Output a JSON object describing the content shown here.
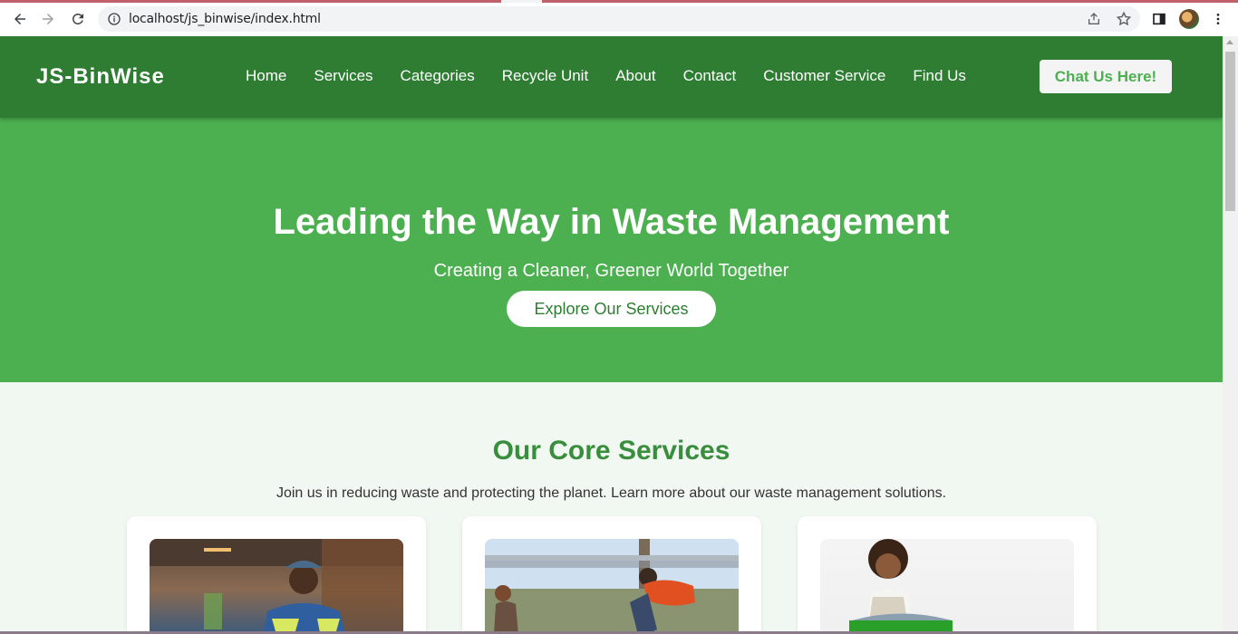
{
  "browser": {
    "url": "localhost/js_binwise/index.html"
  },
  "site": {
    "logo": "JS-BinWise",
    "nav": [
      "Home",
      "Services",
      "Categories",
      "Recycle Unit",
      "About",
      "Contact",
      "Customer Service",
      "Find Us"
    ],
    "chat_button": "Chat Us Here!"
  },
  "hero": {
    "title": "Leading the Way in Waste Management",
    "subtitle": "Creating a Cleaner, Greener World Together",
    "cta": "Explore Our Services"
  },
  "services": {
    "title": "Our Core Services",
    "description": "Join us in reducing waste and protecting the planet. Learn more about our waste management solutions.",
    "cards": [
      {
        "image": "worker-sorting-waste-photo"
      },
      {
        "image": "people-collecting-litter-photo"
      },
      {
        "image": "child-recycling-photo"
      }
    ]
  },
  "colors": {
    "header": "#2e7d32",
    "hero": "#4caf50",
    "accent": "#388e3c"
  }
}
